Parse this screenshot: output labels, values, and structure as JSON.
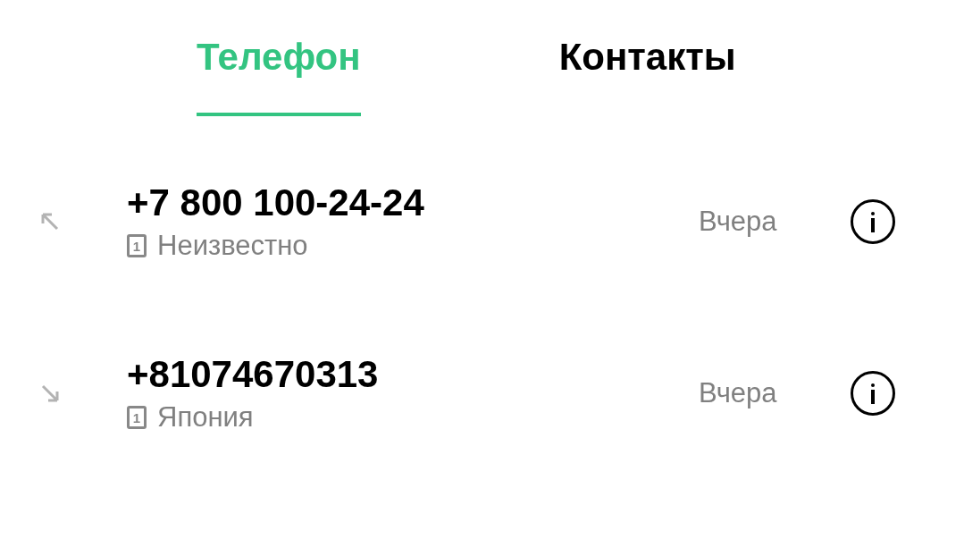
{
  "tabs": [
    {
      "label": "Телефон",
      "selected": true
    },
    {
      "label": "Контакты",
      "selected": false
    }
  ],
  "calls": [
    {
      "number": "+7 800 100-24-24",
      "kind": "outgoing",
      "sim": "1",
      "location": "Неизвестно",
      "time": "Вчера"
    },
    {
      "number": "+81074670313",
      "kind": "incoming",
      "sim": "1",
      "location": "Япония",
      "time": "Вчера"
    }
  ]
}
